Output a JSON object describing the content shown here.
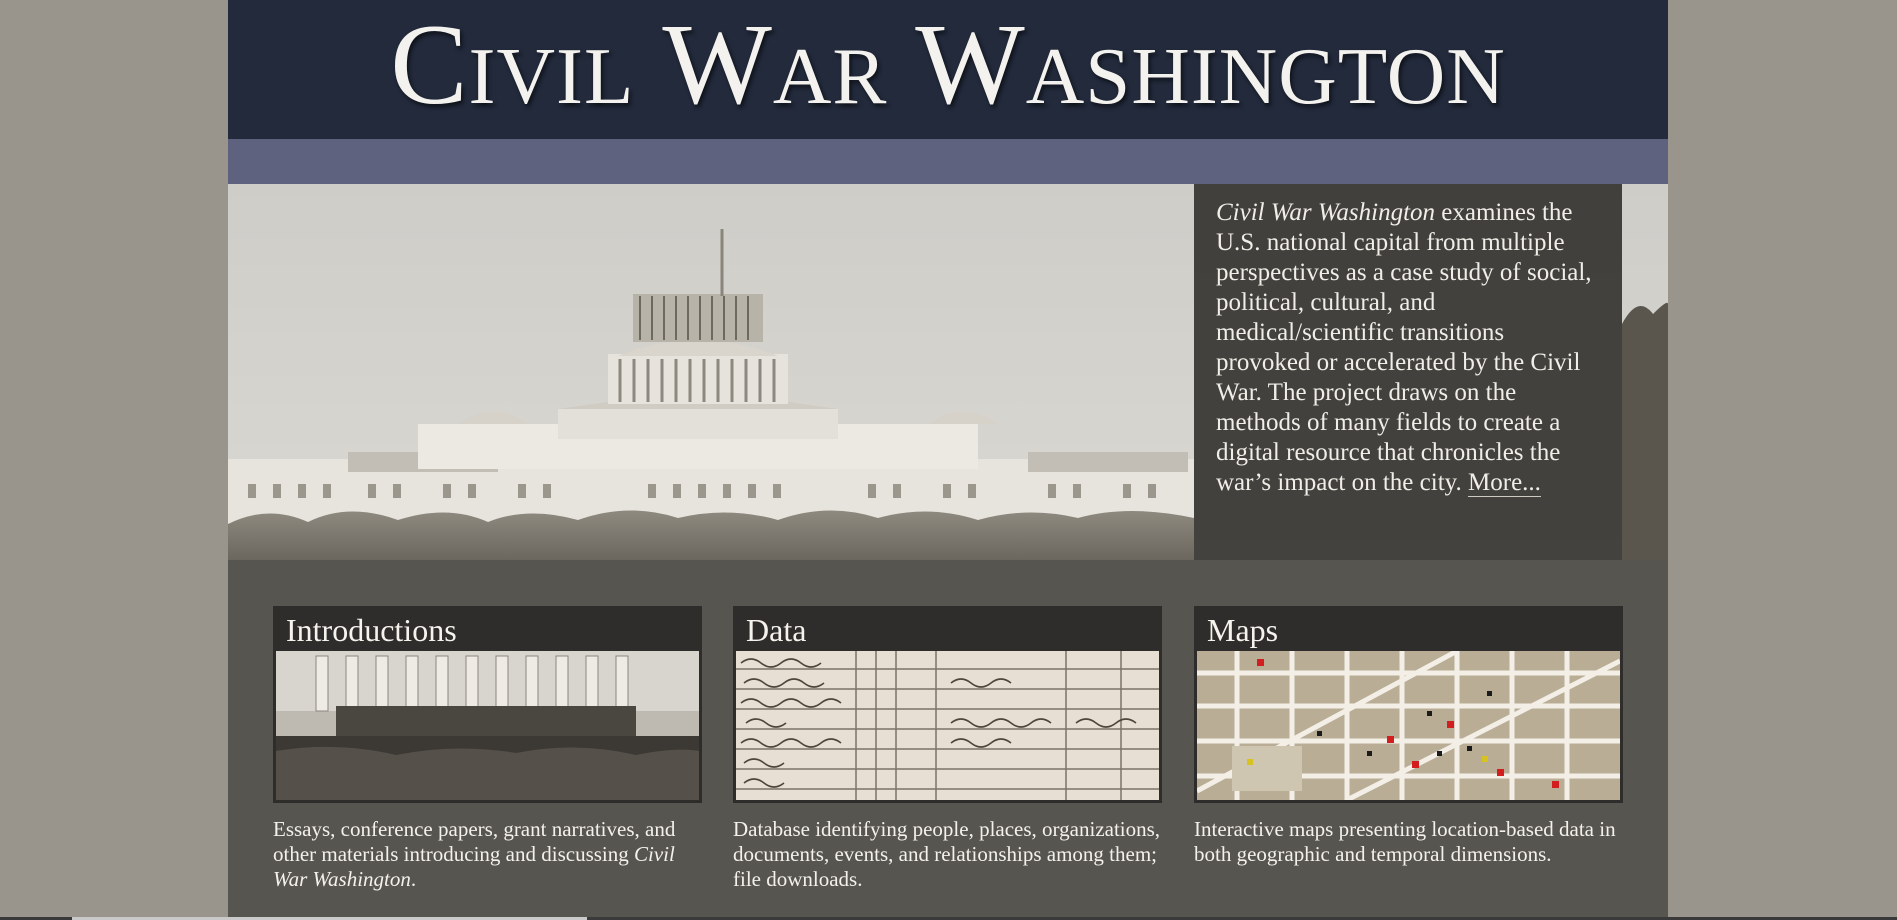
{
  "site": {
    "title": "Civil War Washington"
  },
  "intro": {
    "title_em": "Civil War Washington",
    "text": " examines the U.S. national capital from multiple perspectives as a case study of social, political, cultural, and medical/scientific transitions provoked or accelerated by the Civil War. The project draws on the methods of many fields to create a digital resource that chronicles the war’s impact on the city. ",
    "more_label": "More..."
  },
  "cards": [
    {
      "title": "Introductions",
      "desc": "Essays, conference papers, grant narratives, and other materials introducing and discussing ",
      "desc_em": "Civil War Washington",
      "desc_end": "."
    },
    {
      "title": "Data",
      "desc": "Database identifying people, places, organizations, documents, events, and relationships among them; file downloads."
    },
    {
      "title": "Maps",
      "desc": "Interactive maps presenting location-based data in both geographic and temporal dimensions."
    }
  ],
  "colors": {
    "masthead": "#222a3c",
    "nav_band": "#5e627e",
    "content_bg": "#575550",
    "side_bg": "#9a958c"
  }
}
